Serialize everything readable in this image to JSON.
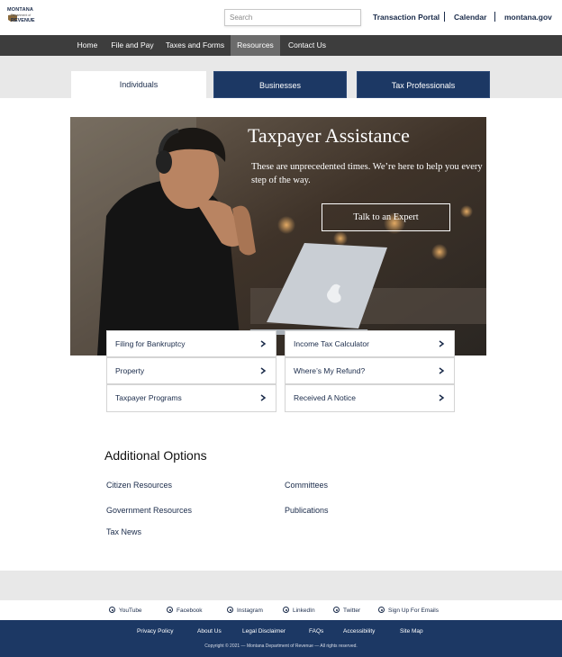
{
  "header": {
    "logo": {
      "line1": "MONTANA",
      "line2": "Department of",
      "line3": "REVENUE"
    },
    "search": {
      "placeholder": "Search"
    },
    "links": [
      "Transaction Portal",
      "Calendar",
      "montana.gov"
    ]
  },
  "nav": {
    "items": [
      "Home",
      "File and Pay",
      "Taxes and Forms",
      "Resources",
      "Contact Us"
    ],
    "active": "Resources"
  },
  "tabs": [
    "Individuals",
    "Businesses",
    "Tax Professionals"
  ],
  "hero": {
    "title": "Taxpayer Assistance",
    "subtitle": "These are unprecedented times. We’re here to help you every step of the way.",
    "button": "Talk to an Expert"
  },
  "quick_links": {
    "left": [
      "Filing for Bankruptcy",
      "Property",
      "Taxpayer Programs"
    ],
    "right": [
      "Income Tax Calculator",
      "Where’s My Refund?",
      "Received A Notice"
    ]
  },
  "additional": {
    "title": "Additional Options",
    "left": [
      "Citizen Resources",
      "Government Resources",
      "Tax News"
    ],
    "right": [
      "Committees",
      "Publications"
    ]
  },
  "social": [
    "YouTube",
    "Facebook",
    "Instagram",
    "LinkedIn",
    "Twitter",
    "Sign Up For Emails"
  ],
  "footer": {
    "links": [
      "Privacy Policy",
      "About Us",
      "Legal Disclaimer",
      "FAQs",
      "Accessibility",
      "Site Map"
    ],
    "copyright": "Copyright © 2021 — Montana Department of Revenue — All rights reserved."
  },
  "colors": {
    "navy": "#1c3864",
    "nav_dark": "#3d3d3d",
    "nav_active": "#6b6b6b",
    "band_gray": "#e8e8e8"
  }
}
